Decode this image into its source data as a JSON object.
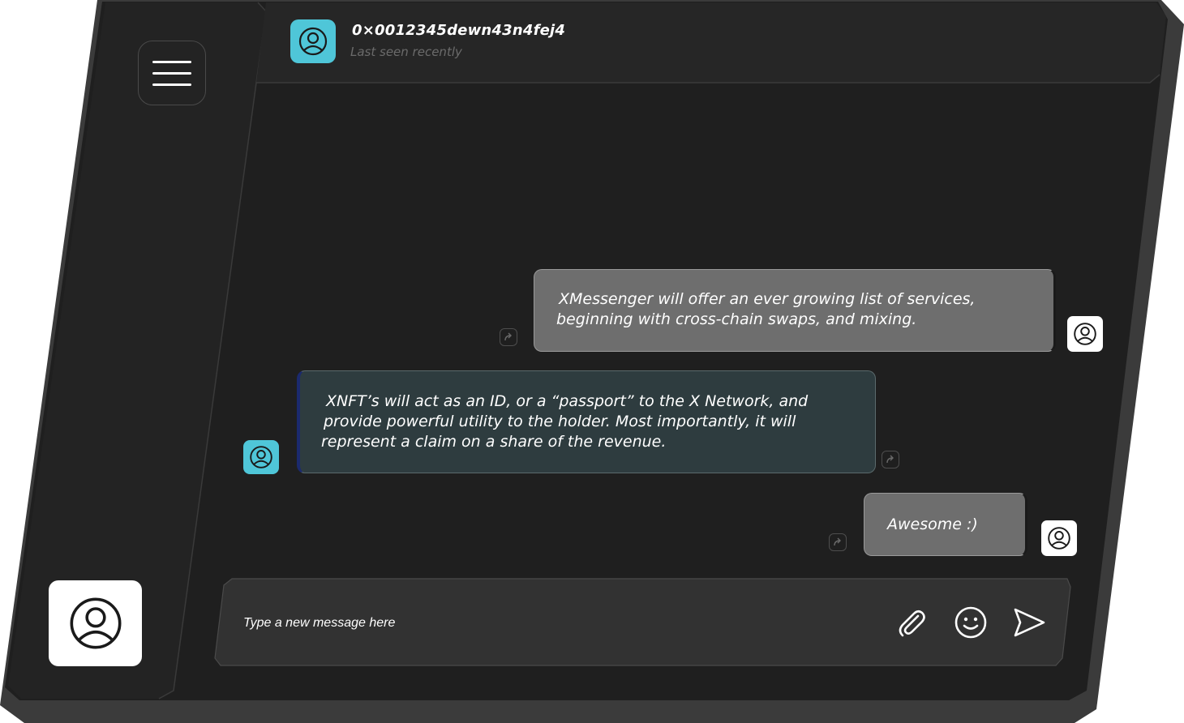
{
  "header": {
    "contact_name": "0×0012345dewn43n4fej4",
    "contact_status": "Last seen recently"
  },
  "messages": [
    {
      "direction": "outgoing",
      "lines": [
        "XMessenger will offer an ever growing list of services,",
        "beginning with cross-chain swaps, and mixing."
      ]
    },
    {
      "direction": "incoming",
      "lines": [
        "XNFT’s will act as an ID, or a “passport” to the X Network, and",
        "provide powerful utility to the holder. Most importantly, it will",
        "represent a claim on a share of the revenue."
      ]
    },
    {
      "direction": "outgoing",
      "lines": [
        "Awesome :)"
      ]
    }
  ],
  "composer": {
    "placeholder": "Type a new message here"
  },
  "icons": {
    "menu": "hamburger-menu-icon",
    "avatar": "user-avatar-icon",
    "share": "share-icon",
    "attach": "paperclip-icon",
    "emoji": "smiley-icon",
    "send": "send-arrow-icon"
  },
  "colors": {
    "accent": "#4fc6d8",
    "background": "#1f1f1f",
    "outgoing_bubble": "#6e6e6e",
    "incoming_bubble": "#2e3c3f"
  }
}
